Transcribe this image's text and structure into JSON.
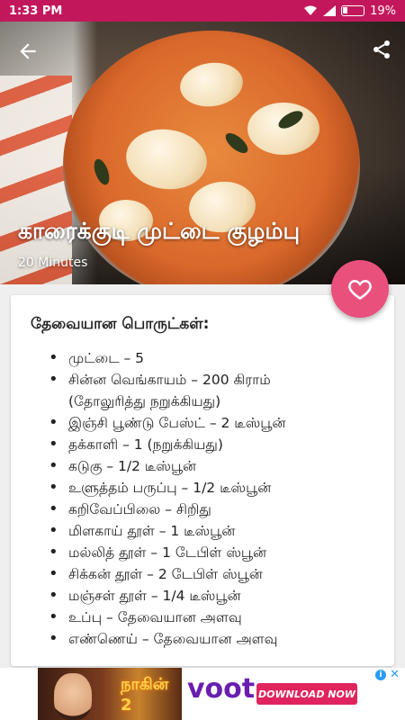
{
  "status": {
    "time": "1:33 PM",
    "battery": "19%"
  },
  "recipe": {
    "title": "காரைக்குடி முட்டை குழம்பு",
    "duration": "20 Minutes"
  },
  "ingredients": {
    "heading": "தேவையான பொருட்கள்:",
    "items": [
      "முட்டை – 5",
      "சின்ன வெங்காயம் – 200 கிராம்",
      "(தோலுரித்து நறுக்கியது)",
      "இஞ்சி பூண்டு பேஸ்ட் – 2 டீஸ்பூன்",
      "தக்காளி – 1 (நறுக்கியது)",
      "கடுகு – 1/2 டீஸ்பூன்",
      "உளுத்தம் பருப்பு – 1/2 டீஸ்பூன்",
      "கறிவேப்பிலை – சிறிது",
      "மிளகாய் தூள் – 1 டீஸ்பூன்",
      "மல்லித் தூள் – 1 டேபிள் ஸ்பூன்",
      "சிக்கன் தூள் – 2 டேபிள் ஸ்பூன்",
      "மஞ்சள் தூள் – 1/4 டீஸ்பூன்",
      "உப்பு – தேவையான அளவு",
      "எண்ணெய் – தேவையான அளவு"
    ]
  },
  "ad": {
    "show_name": "நாகின் 2",
    "brand": "voot",
    "cta": "DOWNLOAD NOW",
    "info": "i",
    "close": "✕"
  },
  "colors": {
    "status_bar": "#c2185b",
    "fab": "#e9507c",
    "card": "#ffffff"
  },
  "icons": {
    "back": "arrow-left-icon",
    "share": "share-icon",
    "favorite": "heart-outline-icon"
  }
}
